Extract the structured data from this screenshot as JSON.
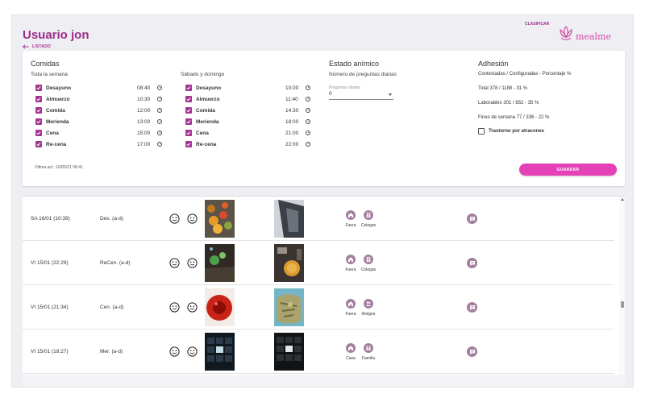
{
  "header": {
    "title": "Usuario jon",
    "back_label": "LISTADO",
    "clasificar_label": "CLASIFICAR",
    "logo_text": "mealme",
    "brand_color": "#9c2e8a",
    "accent_color": "#e542b8"
  },
  "comidas": {
    "title": "Comidas",
    "weekday": {
      "label": "Toda la semana",
      "meals": [
        {
          "name": "Desayuno",
          "time": "08:40",
          "checked": true
        },
        {
          "name": "Almuerzo",
          "time": "10:30",
          "checked": true
        },
        {
          "name": "Comida",
          "time": "12:00",
          "checked": true
        },
        {
          "name": "Merienda",
          "time": "13:00",
          "checked": true
        },
        {
          "name": "Cena",
          "time": "15:00",
          "checked": true
        },
        {
          "name": "Re-cena",
          "time": "17:00",
          "checked": true
        }
      ]
    },
    "weekend": {
      "label": "Sábado y domingo",
      "meals": [
        {
          "name": "Desayuno",
          "time": "10:00",
          "checked": true
        },
        {
          "name": "Almuerzo",
          "time": "11:40",
          "checked": true
        },
        {
          "name": "Comida",
          "time": "14:30",
          "checked": true
        },
        {
          "name": "Merienda",
          "time": "18:00",
          "checked": true
        },
        {
          "name": "Cena",
          "time": "21:00",
          "checked": true
        },
        {
          "name": "Re-cena",
          "time": "22:00",
          "checked": true
        }
      ]
    },
    "last_update": "Última act.: 10/05/21 08:41"
  },
  "estado": {
    "title": "Estado anímico",
    "subtitle": "Número de preguntas diarias",
    "field_label": "Preguntas diarias",
    "field_value": "0"
  },
  "adhesion": {
    "title": "Adhesión",
    "subtitle": "Contestadas / Configuradas - Porcentaje %",
    "total": "Total 378 / 1188 - 31 %",
    "laborables": "Laborables 301 / 852 - 35 %",
    "fines": "Fines de semana 77 / 336 - 22 %",
    "trastorno_label": "Trastorno por atracones",
    "trastorno_checked": false
  },
  "save_label": "GUARDAR",
  "entries": [
    {
      "date": "SA 16/01 (10:39)",
      "type": "Des. (a-d)",
      "place": "Fuera",
      "place_icon": "home-icon",
      "company": "Colegas",
      "company_icon": "people-icon"
    },
    {
      "date": "VI 15/01 (22:29)",
      "type": "ReCen. (a-d)",
      "place": "Fuera",
      "place_icon": "home-icon",
      "company": "Colegas",
      "company_icon": "people-icon"
    },
    {
      "date": "VI 15/01 (21:34)",
      "type": "Cen. (a-d)",
      "place": "Fuera",
      "place_icon": "home-icon",
      "company": "Amigos",
      "company_icon": "friends-icon"
    },
    {
      "date": "VI 15/01 (18:27)",
      "type": "Mer. (a-d)",
      "place": "Casa",
      "place_icon": "home-icon",
      "company": "Familia",
      "company_icon": "family-icon"
    }
  ]
}
